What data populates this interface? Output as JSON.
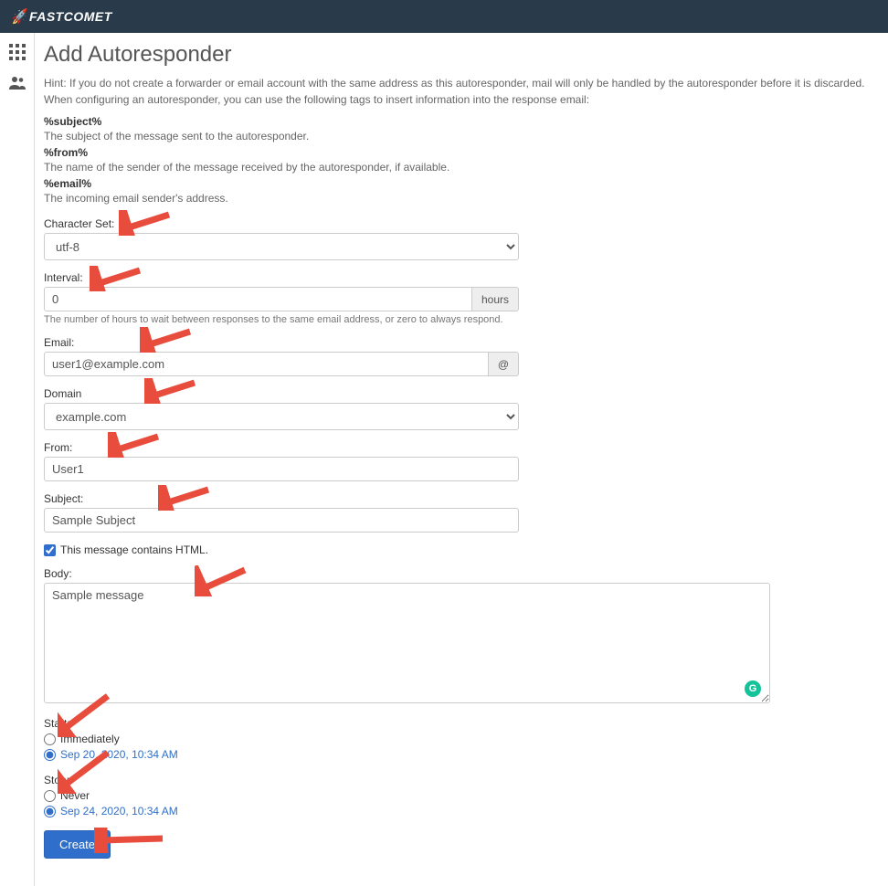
{
  "header": {
    "brand": "FASTCOMET"
  },
  "page": {
    "title": "Add Autoresponder",
    "hint": "Hint: If you do not create a forwarder or email account with the same address as this autoresponder, mail will only be handled by the autoresponder before it is discarded.",
    "tags_intro": "When configuring an autoresponder, you can use the following tags to insert information into the response email:",
    "tags": [
      {
        "name": "%subject%",
        "desc": "The subject of the message sent to the autoresponder."
      },
      {
        "name": "%from%",
        "desc": "The name of the sender of the message received by the autoresponder, if available."
      },
      {
        "name": "%email%",
        "desc": "The incoming email sender's address."
      }
    ]
  },
  "form": {
    "charset": {
      "label": "Character Set:",
      "value": "utf-8"
    },
    "interval": {
      "label": "Interval:",
      "value": "0",
      "addon": "hours",
      "help": "The number of hours to wait between responses to the same email address, or zero to always respond."
    },
    "email": {
      "label": "Email:",
      "value": "user1@example.com",
      "addon": "@"
    },
    "domain": {
      "label": "Domain",
      "value": "example.com"
    },
    "from": {
      "label": "From:",
      "value": "User1"
    },
    "subject": {
      "label": "Subject:",
      "value": "Sample Subject"
    },
    "html_checkbox": {
      "label": "This message contains HTML.",
      "checked": true
    },
    "body": {
      "label": "Body:",
      "value": "Sample message"
    },
    "start": {
      "label": "Start:",
      "options": [
        {
          "label": "Immediately",
          "selected": false
        },
        {
          "label": "Sep 20, 2020, 10:34 AM",
          "selected": true,
          "link": true
        }
      ]
    },
    "stop": {
      "label": "Stop:",
      "options": [
        {
          "label": "Never",
          "selected": false
        },
        {
          "label": "Sep 24, 2020, 10:34 AM",
          "selected": true,
          "link": true
        }
      ]
    },
    "submit": "Create"
  }
}
